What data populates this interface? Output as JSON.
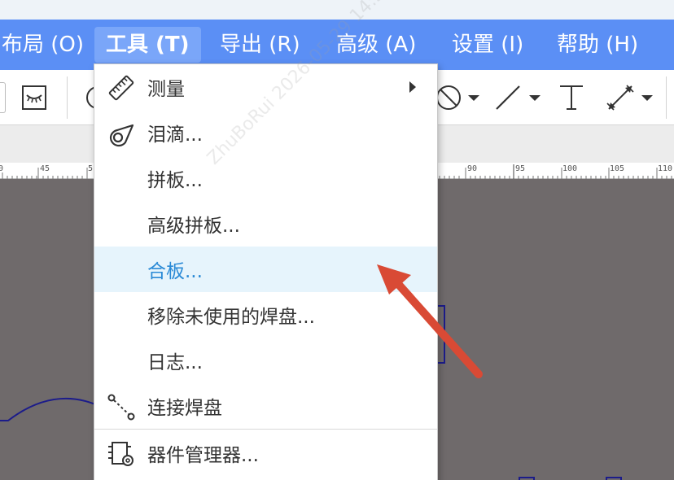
{
  "menubar": {
    "items": [
      {
        "label": "布局 (O)"
      },
      {
        "label": "工具 (T)"
      },
      {
        "label": "导出 (R)"
      },
      {
        "label": "高级 (A)"
      },
      {
        "label": "设置 (I)"
      },
      {
        "label": "帮助 (H)"
      }
    ]
  },
  "ruler": {
    "labels": [
      "0",
      "45",
      "5",
      "90",
      "95",
      "100",
      "105",
      "110"
    ]
  },
  "dropdown": {
    "items": [
      {
        "label": "测量",
        "icon": "ruler-icon",
        "submenu": true
      },
      {
        "label": "泪滴...",
        "icon": "teardrop-icon"
      },
      {
        "label": "拼板...",
        "icon": ""
      },
      {
        "label": "高级拼板...",
        "icon": ""
      },
      {
        "label": "合板...",
        "icon": "",
        "highlighted": true
      },
      {
        "label": "移除未使用的焊盘...",
        "icon": ""
      },
      {
        "label": "日志...",
        "icon": ""
      },
      {
        "label": "连接焊盘",
        "icon": "connect-pads-icon"
      },
      {
        "label": "器件管理器...",
        "icon": "component-manager-icon"
      }
    ]
  },
  "watermark": {
    "text": "ZhuBoRui  2026-05-29 14:56:17"
  },
  "colors": {
    "menubar": "#5b8ff5",
    "highlight": "#e6f4fc",
    "highlight_text": "#2a8ad6",
    "annotation_arrow": "#d94a35",
    "canvas": "#6f6a6b"
  }
}
